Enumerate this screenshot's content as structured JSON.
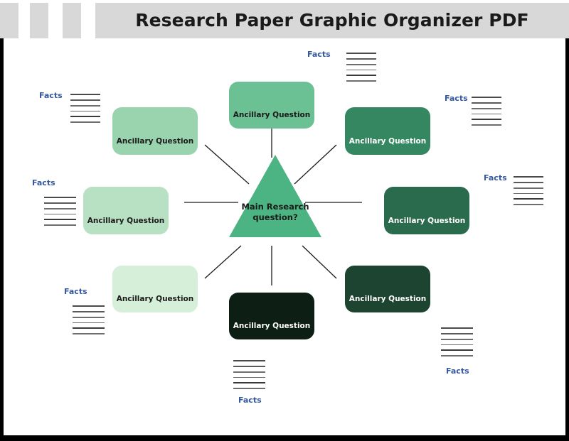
{
  "header": {
    "title": "Research Paper Graphic Organizer PDF",
    "decor_blocks": 3,
    "background": "#d8d8d8"
  },
  "diagram": {
    "center": {
      "label": "Main Research\nquestion?",
      "line1": "Main Research",
      "line2": "question?",
      "shape": "triangle",
      "fill": "#4CB382",
      "text_color": "#1a1a1a"
    },
    "nodes": [
      {
        "id": "top",
        "label": "Ancillary Question",
        "fill": "#6BC193",
        "text_color": "#1a1a1a"
      },
      {
        "id": "upper-left",
        "label": "Ancillary Question",
        "fill": "#9AD4AE",
        "text_color": "#1a1a1a"
      },
      {
        "id": "left",
        "label": "Ancillary Question",
        "fill": "#B8E0C2",
        "text_color": "#1a1a1a"
      },
      {
        "id": "lower-left",
        "label": "Ancillary Question",
        "fill": "#D6EFD9",
        "text_color": "#1a1a1a"
      },
      {
        "id": "bottom",
        "label": "Ancillary Question",
        "fill": "#0D1F14",
        "text_color": "#ffffff"
      },
      {
        "id": "lower-right",
        "label": "Ancillary Question",
        "fill": "#1C4430",
        "text_color": "#ffffff"
      },
      {
        "id": "right",
        "label": "Ancillary Question",
        "fill": "#2A6B4D",
        "text_color": "#ffffff"
      },
      {
        "id": "upper-right",
        "label": "Ancillary Question",
        "fill": "#348761",
        "text_color": "#ffffff"
      }
    ],
    "fact_groups": [
      {
        "id": "facts-top",
        "label": "Facts",
        "lines": 6
      },
      {
        "id": "facts-upper-left",
        "label": "Facts",
        "lines": 6
      },
      {
        "id": "facts-left",
        "label": "Facts",
        "lines": 6
      },
      {
        "id": "facts-lower-left",
        "label": "Facts",
        "lines": 6
      },
      {
        "id": "facts-bottom",
        "label": "Facts",
        "lines": 6
      },
      {
        "id": "facts-lower-right",
        "label": "Facts",
        "lines": 6
      },
      {
        "id": "facts-right",
        "label": "Facts",
        "lines": 6
      },
      {
        "id": "facts-upper-right",
        "label": "Facts",
        "lines": 6
      }
    ],
    "connector_color": "#1a1a1a",
    "fact_line_color": "#6e6e6e",
    "fact_label_color": "#35589e"
  }
}
